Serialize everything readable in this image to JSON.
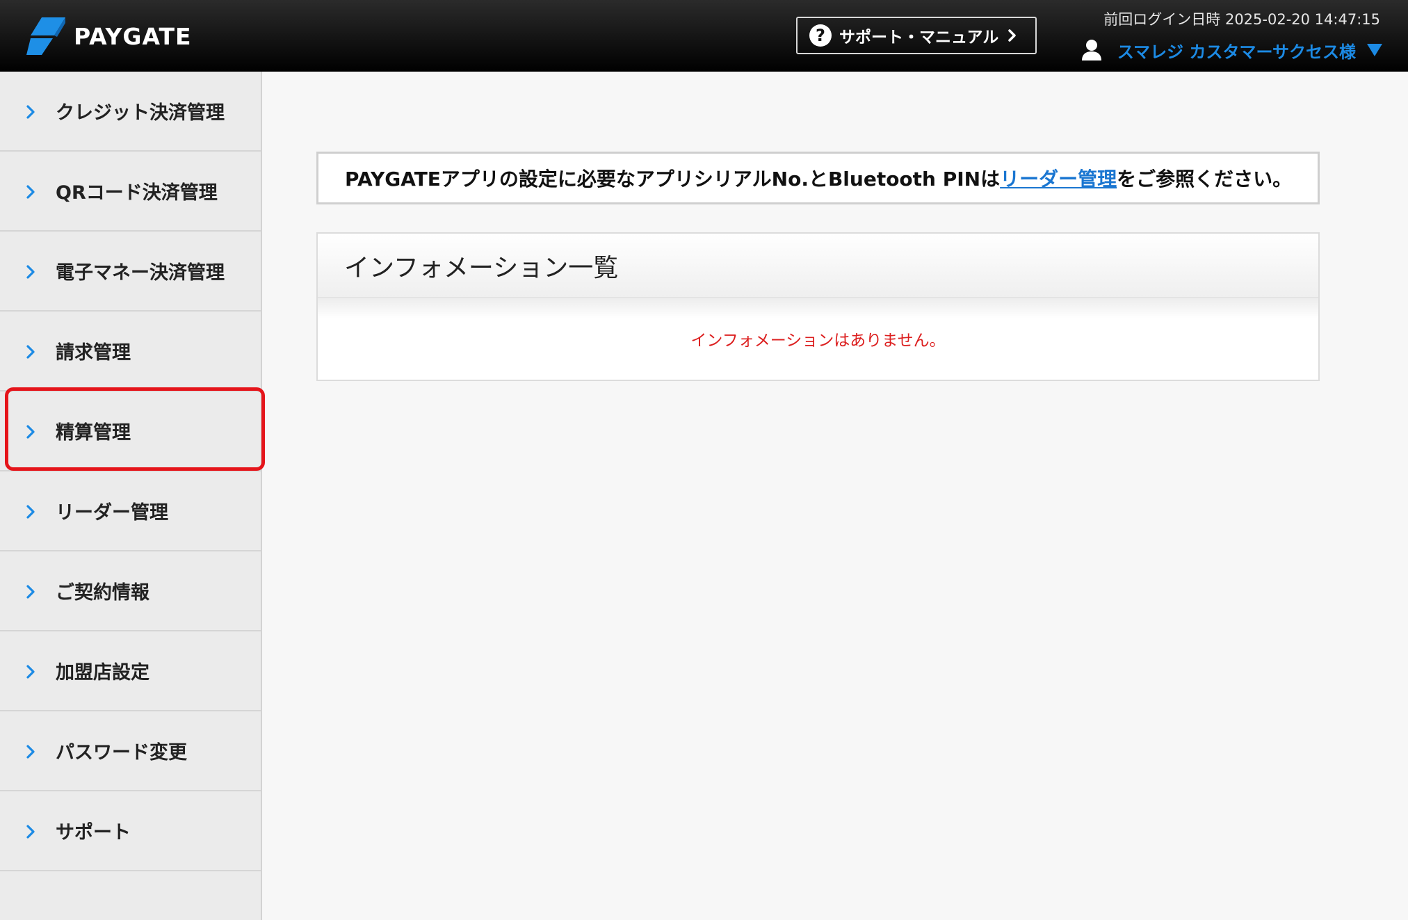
{
  "header": {
    "logo_text": "PAYGATE",
    "support_button": "サポート・マニュアル",
    "last_login": "前回ログイン日時 2025-02-20 14:47:15",
    "user_name": "スマレジ カスタマーサクセス様"
  },
  "sidebar": {
    "items": [
      {
        "label": "クレジット決済管理"
      },
      {
        "label": "QRコード決済管理"
      },
      {
        "label": "電子マネー決済管理"
      },
      {
        "label": "請求管理"
      },
      {
        "label": "精算管理"
      },
      {
        "label": "リーダー管理"
      },
      {
        "label": "ご契約情報"
      },
      {
        "label": "加盟店設定"
      },
      {
        "label": "パスワード変更"
      },
      {
        "label": "サポート"
      }
    ],
    "highlighted_index": 4
  },
  "notice": {
    "prefix": "PAYGATEアプリの設定に必要なアプリシリアルNo.とBluetooth PINは",
    "link": "リーダー管理",
    "suffix": "をご参照ください。"
  },
  "info_panel": {
    "title": "インフォメーション一覧",
    "empty_message": "インフォメーションはありません。"
  },
  "colors": {
    "accent_blue": "#1c8ae4",
    "link_blue": "#1a76d1",
    "highlight_red": "#e5141a",
    "message_red": "#dc1f1f"
  }
}
